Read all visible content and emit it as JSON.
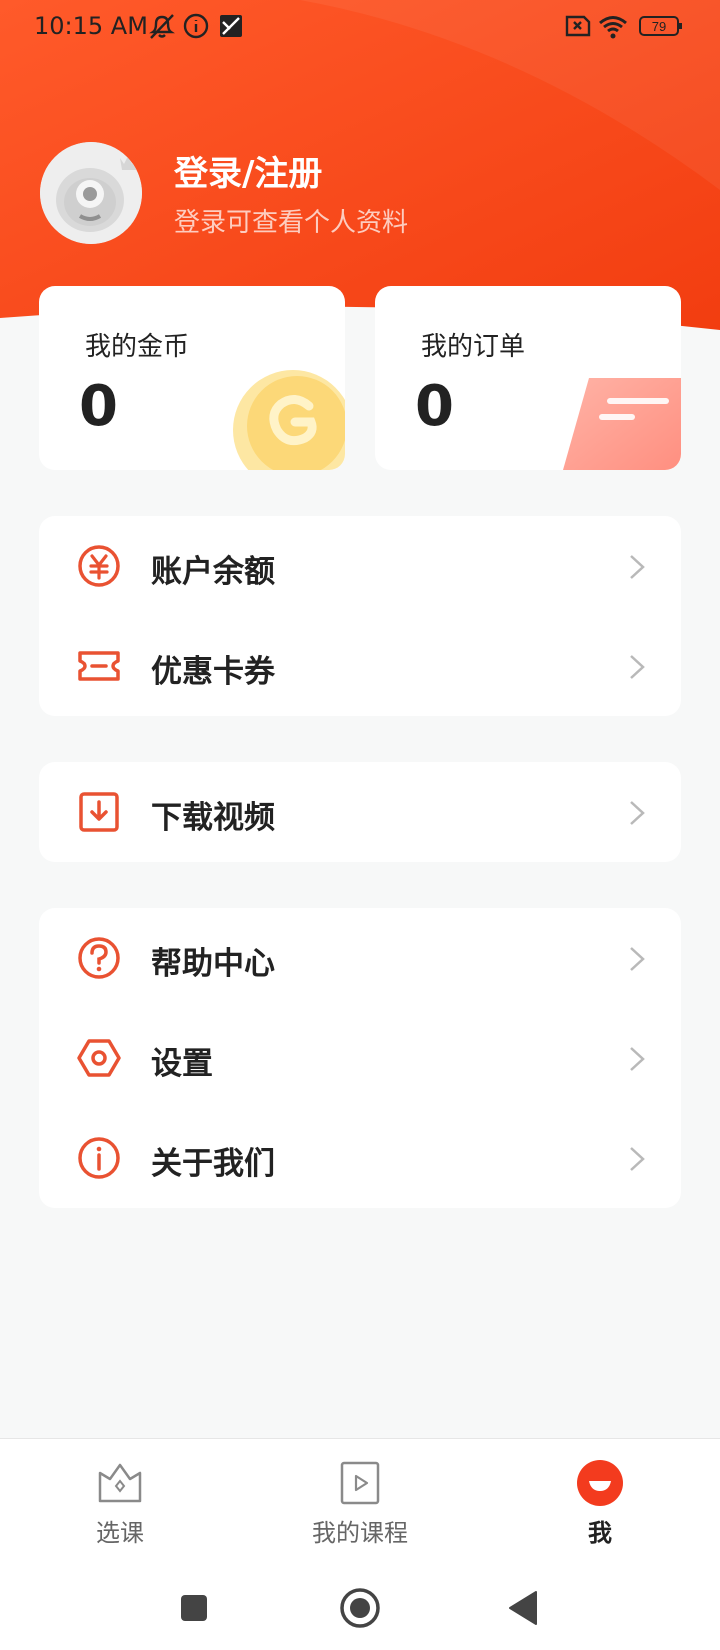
{
  "status_bar": {
    "time": "10:15 AM",
    "battery": "79",
    "icons_left": [
      "mute-bell-icon",
      "info-circle-icon",
      "sim-card-icon"
    ],
    "icons_right": [
      "no-sim-icon",
      "wifi-icon",
      "battery-icon"
    ]
  },
  "colors": {
    "brand": "#fb4d1f",
    "brand_dark": "#f23d10",
    "icon_accent": "#e95232",
    "coin": "#fde8a6"
  },
  "profile": {
    "title": "登录/注册",
    "subtitle": "登录可查看个人资料"
  },
  "cards": [
    {
      "label": "我的金币",
      "value": "0",
      "icon": "coin-icon"
    },
    {
      "label": "我的订单",
      "value": "0",
      "icon": "order-icon"
    }
  ],
  "menu": {
    "balance": "账户余额",
    "coupons": "优惠卡券",
    "downloads": "下载视频",
    "help": "帮助中心",
    "settings": "设置",
    "about": "关于我们"
  },
  "tabbar": {
    "tabs": [
      {
        "label": "选课",
        "icon": "course-select-icon"
      },
      {
        "label": "我的课程",
        "icon": "my-course-icon"
      },
      {
        "label": "我",
        "icon": "me-icon",
        "active": true
      }
    ]
  },
  "navbar": [
    "recent-apps-button",
    "home-button",
    "back-button"
  ]
}
